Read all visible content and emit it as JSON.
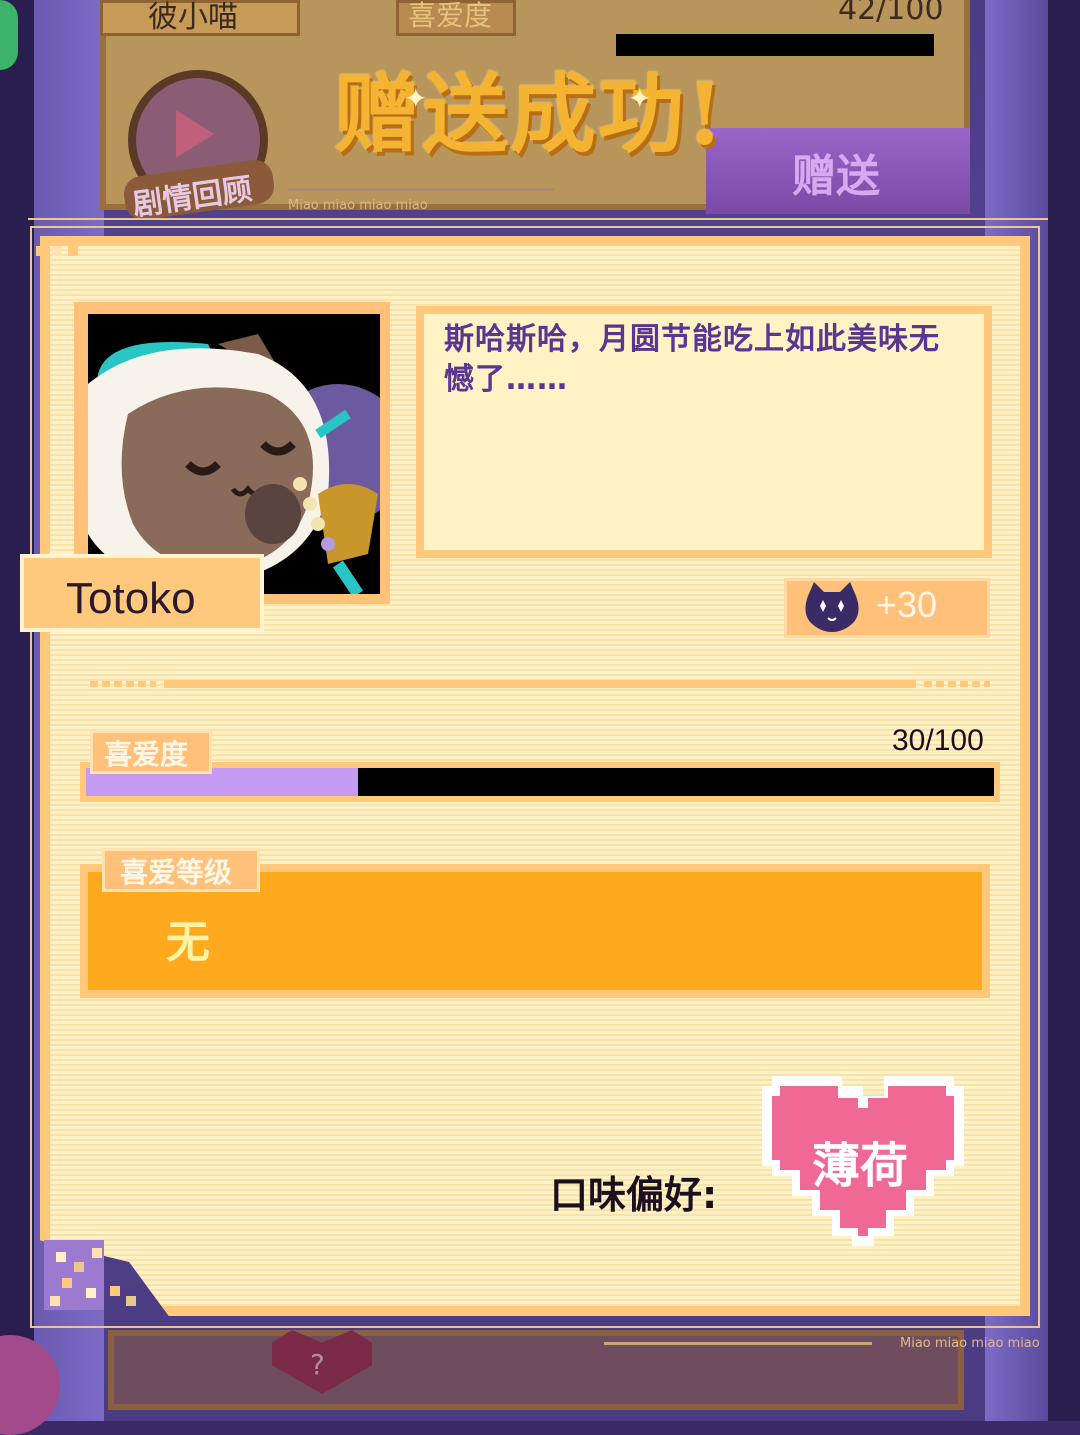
{
  "background": {
    "character_name": "彼小喵",
    "like_label": "喜爱度",
    "like_score": "42/100",
    "like_fraction": 0.42,
    "gift_button": "赠送",
    "review_label": "剧情回顾",
    "miao_text": "Miao miao miao miao",
    "success_title": "赠送成功!"
  },
  "card": {
    "name": "Totoko",
    "dialog": "斯哈斯哈，月圆节能吃上如此美味无憾了……",
    "bonus": "+30",
    "affection": {
      "label": "喜爱度",
      "score": "30/100",
      "fraction": 0.3
    },
    "level": {
      "label": "喜爱等级",
      "value": "无"
    },
    "flavor": {
      "label": "口味偏好:",
      "value": "薄荷"
    }
  },
  "colors": {
    "panel_bg": "#fff1c6",
    "panel_border": "#ffc87a",
    "level_box": "#ffaa1e",
    "bar_fill": "#c59af2",
    "dialog_text": "#5a3592",
    "heart": "#f06894"
  }
}
